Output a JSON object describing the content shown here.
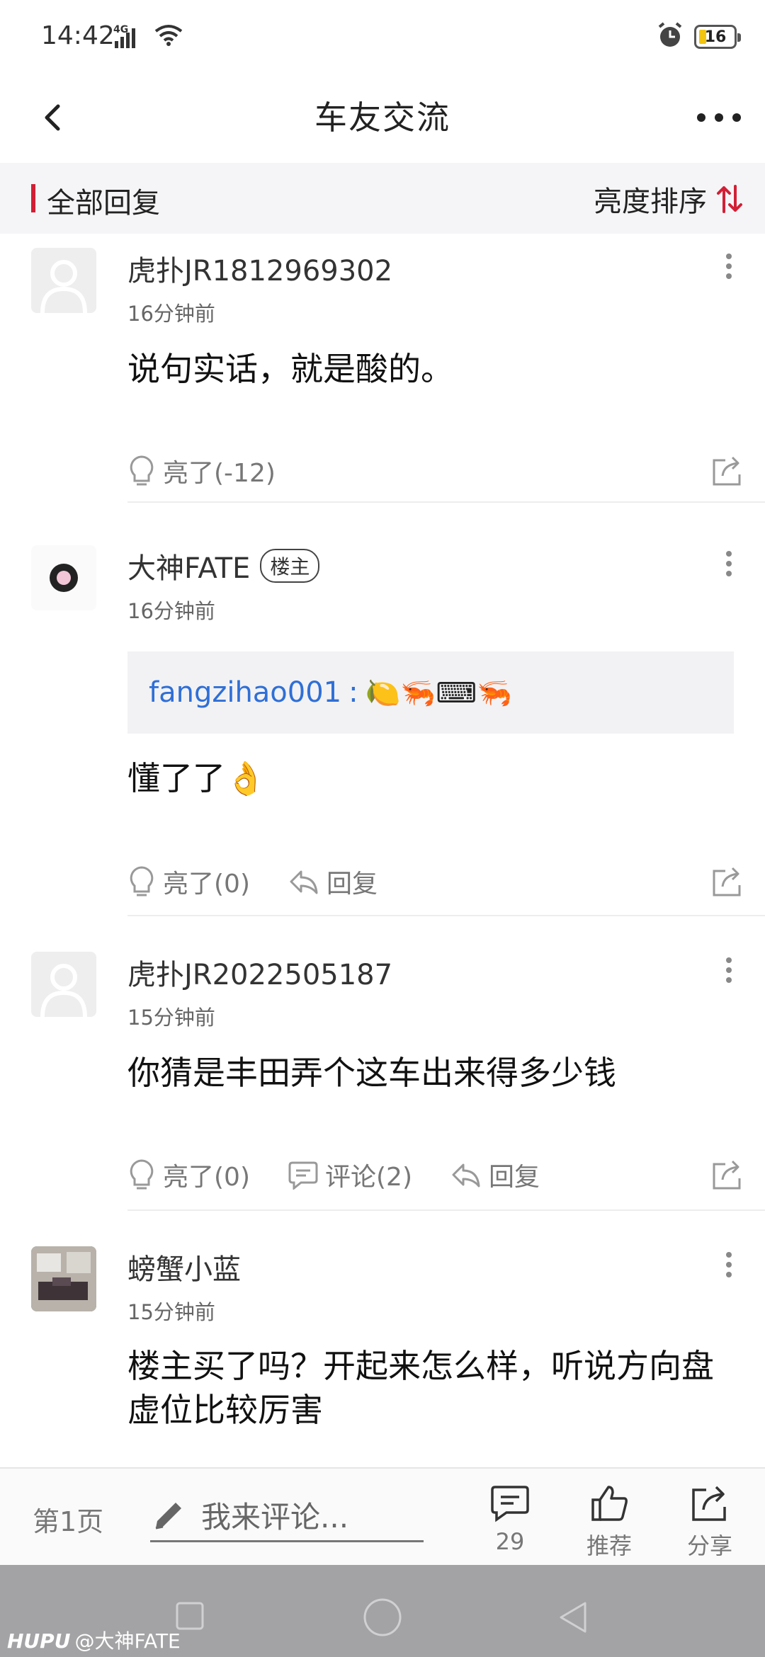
{
  "status_bar": {
    "time": "14:42",
    "network": "4G",
    "battery": "16"
  },
  "nav": {
    "title": "车友交流"
  },
  "section": {
    "title": "全部回复",
    "sort_label": "亮度排序"
  },
  "comments": [
    {
      "user": "虎扑JR1812969302",
      "time": "16分钟前",
      "text": "说句实话，就是酸的。",
      "light_label": "亮了(-12)"
    },
    {
      "user": "大神FATE",
      "badge": "楼主",
      "time": "16分钟前",
      "quote_user": "fangzihao001",
      "quote_colon": ":",
      "quote_text": "🍋🦐⌨🦐",
      "text": "懂了了👌",
      "light_label": "亮了(0)",
      "reply_label": "回复"
    },
    {
      "user": "虎扑JR2022505187",
      "time": "15分钟前",
      "text": "你猜是丰田弄个这车出来得多少钱",
      "light_label": "亮了(0)",
      "comment_label": "评论(2)",
      "reply_label": "回复"
    },
    {
      "user": "螃蟹小蓝",
      "time": "15分钟前",
      "text": "楼主买了吗？开起来怎么样，听说方向盘虚位比较厉害"
    }
  ],
  "bottom_bar": {
    "page_label": "第1页",
    "input_placeholder": "我来评论...",
    "comment_count": "29",
    "recommend_label": "推荐",
    "share_label": "分享"
  },
  "watermark": {
    "logo": "HUPU",
    "text": "@大神FATE"
  },
  "colors": {
    "accent": "#d21f35",
    "link": "#2f6fd6",
    "section_bg": "#f5f5f7"
  }
}
